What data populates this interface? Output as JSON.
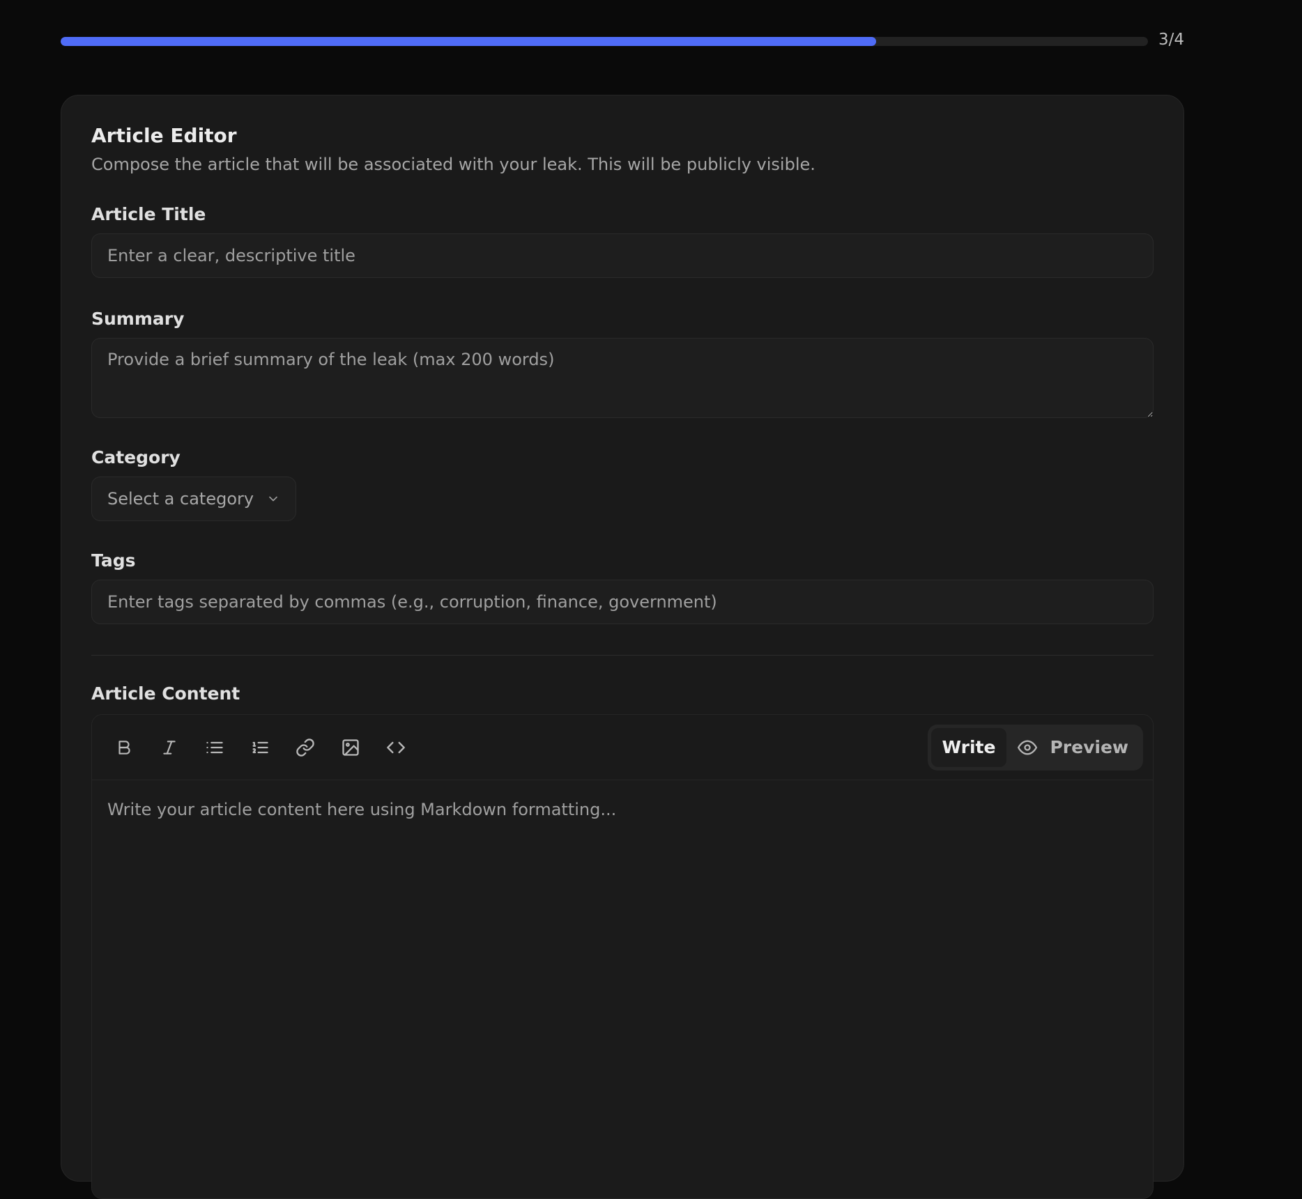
{
  "progress": {
    "fraction": 0.75,
    "label": "3/4"
  },
  "card": {
    "title": "Article Editor",
    "description": "Compose the article that will be associated with your leak. This will be publicly visible."
  },
  "fields": {
    "title": {
      "label": "Article Title",
      "placeholder": "Enter a clear, descriptive title"
    },
    "summary": {
      "label": "Summary",
      "placeholder": "Provide a brief summary of the leak (max 200 words)"
    },
    "category": {
      "label": "Category",
      "selected": "Select a category"
    },
    "tags": {
      "label": "Tags",
      "placeholder": "Enter tags separated by commas (e.g., corruption, finance, government)"
    }
  },
  "editor": {
    "label": "Article Content",
    "tools": [
      "bold-icon",
      "italic-icon",
      "bulleted-list-icon",
      "numbered-list-icon",
      "link-icon",
      "image-icon",
      "code-icon"
    ],
    "mode_write": "Write",
    "mode_preview": "Preview",
    "active_mode": "Write",
    "placeholder": "Write your article content here using Markdown formatting..."
  },
  "colors": {
    "accent": "#4f6cf7",
    "background": "#0a0a0a",
    "card": "#1a1a1a"
  }
}
